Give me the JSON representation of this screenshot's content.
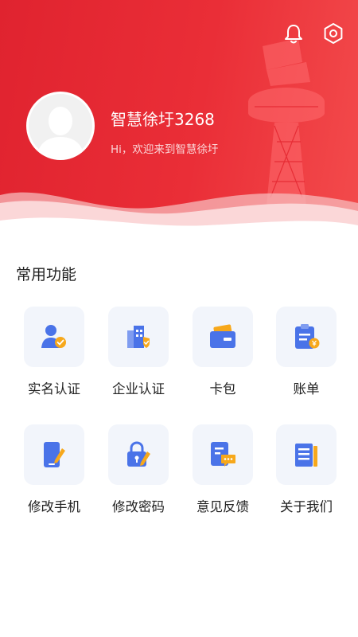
{
  "header": {
    "username": "智慧徐圩3268",
    "greeting": "Hi，欢迎来到智慧徐圩",
    "icons": [
      "bell-icon",
      "settings-gear-icon"
    ]
  },
  "section": {
    "title": "常用功能"
  },
  "functions": [
    {
      "label": "实名认证",
      "icon": "id-verify-icon"
    },
    {
      "label": "企业认证",
      "icon": "enterprise-verify-icon"
    },
    {
      "label": "卡包",
      "icon": "card-wallet-icon"
    },
    {
      "label": "账单",
      "icon": "bill-icon"
    },
    {
      "label": "修改手机",
      "icon": "edit-phone-icon"
    },
    {
      "label": "修改密码",
      "icon": "edit-password-icon"
    },
    {
      "label": "意见反馈",
      "icon": "feedback-icon"
    },
    {
      "label": "关于我们",
      "icon": "about-icon"
    }
  ],
  "colors": {
    "header_red": "#e8262f",
    "icon_blue": "#4a73e8",
    "icon_orange": "#f7a81b",
    "tile_bg": "#f2f5fb"
  }
}
